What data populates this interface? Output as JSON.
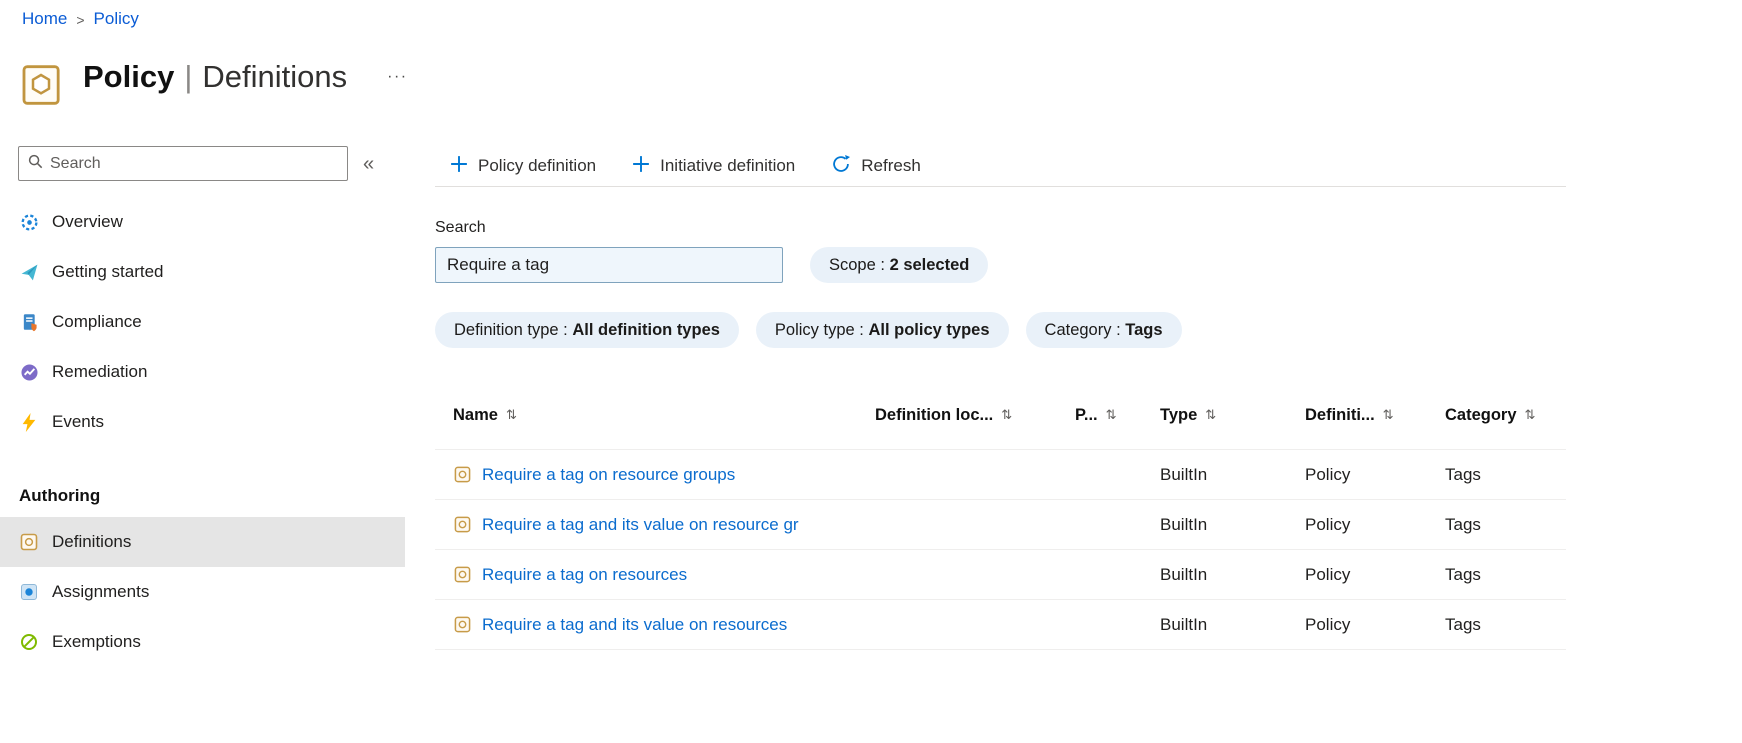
{
  "breadcrumb": {
    "items": [
      {
        "label": "Home"
      },
      {
        "label": "Policy"
      }
    ],
    "separator": ">"
  },
  "header": {
    "title_primary": "Policy",
    "title_separator": "|",
    "title_secondary": "Definitions",
    "more_label": "···"
  },
  "sidebar": {
    "search": {
      "placeholder": "Search"
    },
    "collapse_glyph": "«",
    "items": [
      {
        "label": "Overview",
        "icon": "overview-icon"
      },
      {
        "label": "Getting started",
        "icon": "getting-started-icon"
      },
      {
        "label": "Compliance",
        "icon": "compliance-icon"
      },
      {
        "label": "Remediation",
        "icon": "remediation-icon"
      },
      {
        "label": "Events",
        "icon": "events-icon"
      }
    ],
    "section_header": "Authoring",
    "authoring_items": [
      {
        "label": "Definitions",
        "icon": "definitions-icon",
        "selected": true
      },
      {
        "label": "Assignments",
        "icon": "assignments-icon",
        "selected": false
      },
      {
        "label": "Exemptions",
        "icon": "exemptions-icon",
        "selected": false
      }
    ]
  },
  "toolbar": {
    "buttons": [
      {
        "label": "Policy definition",
        "icon": "plus-icon"
      },
      {
        "label": "Initiative definition",
        "icon": "plus-icon"
      },
      {
        "label": "Refresh",
        "icon": "refresh-icon"
      }
    ]
  },
  "filters": {
    "search_label": "Search",
    "search_value": "Require a tag",
    "separator": " : ",
    "scope_pill": {
      "name": "Scope",
      "value": "2 selected"
    },
    "pills": [
      {
        "name": "Definition type",
        "value": "All definition types"
      },
      {
        "name": "Policy type",
        "value": "All policy types"
      },
      {
        "name": "Category",
        "value": "Tags"
      }
    ]
  },
  "table": {
    "sort_glyph": "⇅",
    "columns": [
      "Name",
      "Definition loc...",
      "P...",
      "Type",
      "Definiti...",
      "Category"
    ],
    "rows": [
      {
        "name": "Require a tag on resource groups",
        "definition_location": "",
        "policies": "",
        "type": "BuiltIn",
        "definition_type": "Policy",
        "category": "Tags"
      },
      {
        "name": "Require a tag and its value on resource gr",
        "definition_location": "",
        "policies": "",
        "type": "BuiltIn",
        "definition_type": "Policy",
        "category": "Tags"
      },
      {
        "name": "Require a tag on resources",
        "definition_location": "",
        "policies": "",
        "type": "BuiltIn",
        "definition_type": "Policy",
        "category": "Tags"
      },
      {
        "name": "Require a tag and its value on resources",
        "definition_location": "",
        "policies": "",
        "type": "BuiltIn",
        "definition_type": "Policy",
        "category": "Tags"
      }
    ],
    "colors": {
      "link": "#0078d4",
      "accent": "#0078d4"
    }
  }
}
